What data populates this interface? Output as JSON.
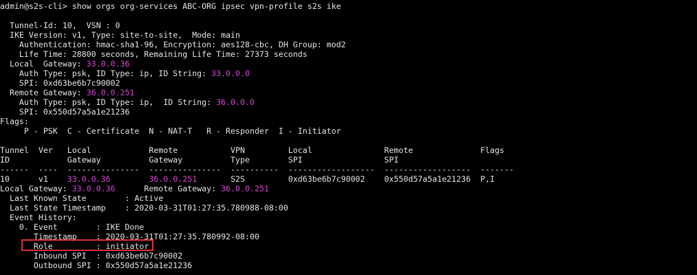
{
  "terminal": {
    "colors": {
      "background": "#000000",
      "text": "#e6e6e6",
      "ip_highlight": "#d445d4",
      "annotation_box": "#e03030"
    },
    "lines": [
      {
        "segments": [
          {
            "text": "admin@s2s-cli> show orgs org-services ABC-ORG ipsec vpn-profile s2s ike"
          }
        ]
      },
      {
        "segments": [
          {
            "text": ""
          }
        ]
      },
      {
        "segments": [
          {
            "text": "  Tunnel-Id: 10,  VSN : 0"
          }
        ]
      },
      {
        "segments": [
          {
            "text": "  IKE Version: v1, Type: site-to-site,  Mode: main"
          }
        ]
      },
      {
        "segments": [
          {
            "text": "    Authentication: hmac-sha1-96, Encryption: aes128-cbc, DH Group: mod2"
          }
        ]
      },
      {
        "segments": [
          {
            "text": "    Life Time: 28800 seconds, Remaining Life Time: 27373 seconds"
          }
        ]
      },
      {
        "segments": [
          {
            "text": "  Local  Gateway: "
          },
          {
            "text": "33.0.0.36",
            "hl": true
          }
        ]
      },
      {
        "segments": [
          {
            "text": "    Auth Type: psk, ID Type: ip, ID String: "
          },
          {
            "text": "33.0.0.0",
            "hl": true
          }
        ]
      },
      {
        "segments": [
          {
            "text": "    SPI: 0xd63be6b7c90002"
          }
        ]
      },
      {
        "segments": [
          {
            "text": "  Remote Gateway: "
          },
          {
            "text": "36.0.0.251",
            "hl": true
          }
        ]
      },
      {
        "segments": [
          {
            "text": "    Auth Type: psk, ID Type: ip,  ID String: "
          },
          {
            "text": "36.0.0.0",
            "hl": true
          }
        ]
      },
      {
        "segments": [
          {
            "text": "    SPI: 0x550d57a5a1e21236"
          }
        ]
      },
      {
        "segments": [
          {
            "text": "Flags:"
          }
        ]
      },
      {
        "segments": [
          {
            "text": "     P - PSK  C - Certificate  N - NAT-T   R - Responder  I - Initiator"
          }
        ]
      },
      {
        "segments": [
          {
            "text": ""
          }
        ]
      },
      {
        "segments": [
          {
            "text": "Tunnel  Ver   Local            Remote           VPN         Local               Remote              Flags"
          }
        ]
      },
      {
        "segments": [
          {
            "text": "ID            Gateway          Gateway          Type        SPI                 SPI"
          }
        ]
      },
      {
        "segments": [
          {
            "text": "------  ----  ---------------  ---------------  ----------  ------------------  ------------------  -------"
          }
        ]
      },
      {
        "segments": [
          {
            "text": "10      v1    "
          },
          {
            "text": "33.0.0.36",
            "hl": true
          },
          {
            "text": "        "
          },
          {
            "text": "36.0.0.251",
            "hl": true
          },
          {
            "text": "       S2S         0xd63be6b7c90002    0x550d57a5a1e21236  P,I"
          }
        ]
      },
      {
        "segments": [
          {
            "text": "Local Gateway: "
          },
          {
            "text": "33.0.0.36",
            "hl": true
          },
          {
            "text": "      Remote Gateway: "
          },
          {
            "text": "36.0.0.251",
            "hl": true
          }
        ]
      },
      {
        "segments": [
          {
            "text": "  Last Known State        : Active"
          }
        ]
      },
      {
        "segments": [
          {
            "text": "  Last State Timestamp    : 2020-03-31T01:27:35.780988-08:00"
          }
        ]
      },
      {
        "segments": [
          {
            "text": "  Event History:"
          }
        ]
      },
      {
        "segments": [
          {
            "text": "    0. Event        : IKE Done"
          }
        ]
      },
      {
        "segments": [
          {
            "text": "       Timestamp    : 2020-03-31T01:27:35.780992-08:00"
          }
        ]
      },
      {
        "segments": [
          {
            "text": "       Role         : initiator"
          }
        ]
      },
      {
        "segments": [
          {
            "text": "       Inbound SPI  : 0xd63be6b7c90002"
          }
        ]
      },
      {
        "segments": [
          {
            "text": "       Outbound SPI : 0x550d57a5a1e21236"
          }
        ]
      }
    ]
  }
}
